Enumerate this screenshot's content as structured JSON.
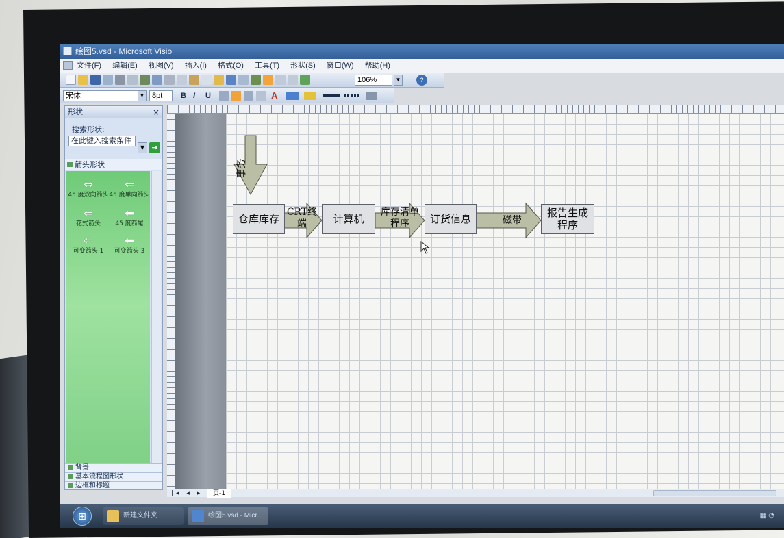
{
  "window": {
    "title": "绘图5.vsd - Microsoft Visio"
  },
  "menubar": {
    "items": [
      "文件(F)",
      "编辑(E)",
      "视图(V)",
      "插入(I)",
      "格式(O)",
      "工具(T)",
      "形状(S)",
      "窗口(W)",
      "帮助(H)"
    ]
  },
  "toolbar": {
    "zoom": "106%",
    "font": "宋体",
    "font_size": "8pt",
    "bold": "B",
    "italic": "I",
    "underline": "U",
    "font_color": "A"
  },
  "shapes_pane": {
    "title": "形状",
    "close": "×",
    "search_label": "搜索形状:",
    "search_placeholder": "在此键入搜索条件",
    "stencil_title": "箭头形状",
    "shapes": [
      {
        "label": "45 度双向箭头",
        "glyph": "⇔"
      },
      {
        "label": "45 度单向箭头",
        "glyph": "⇐"
      },
      {
        "label": "花式箭头",
        "glyph": "⇐"
      },
      {
        "label": "45 度箭尾",
        "glyph": "⬅"
      },
      {
        "label": "可变箭头 1",
        "glyph": "⇦"
      },
      {
        "label": "可变箭头 3",
        "glyph": "⬅"
      }
    ],
    "footer_stencils": [
      "背景",
      "基本流程图形状",
      "边框和标题"
    ]
  },
  "diagram": {
    "boxes": [
      {
        "id": "warehouse",
        "label": "仓库库存"
      },
      {
        "id": "computer",
        "label": "计算机"
      },
      {
        "id": "order",
        "label": "订货信息"
      },
      {
        "id": "report",
        "label": "报告生成程序"
      }
    ],
    "arrows": [
      {
        "id": "affairs",
        "label": "事务"
      },
      {
        "id": "crt",
        "label": "CRT终端"
      },
      {
        "id": "inventory",
        "label": "库存清单程序"
      },
      {
        "id": "tape",
        "label": "磁带"
      }
    ],
    "arrow_fill": "#b9bea4"
  },
  "pagebar": {
    "page_tab": "页-1"
  },
  "taskbar": {
    "items": [
      "新建文件夹",
      "绘图5.vsd - Micr..."
    ]
  }
}
